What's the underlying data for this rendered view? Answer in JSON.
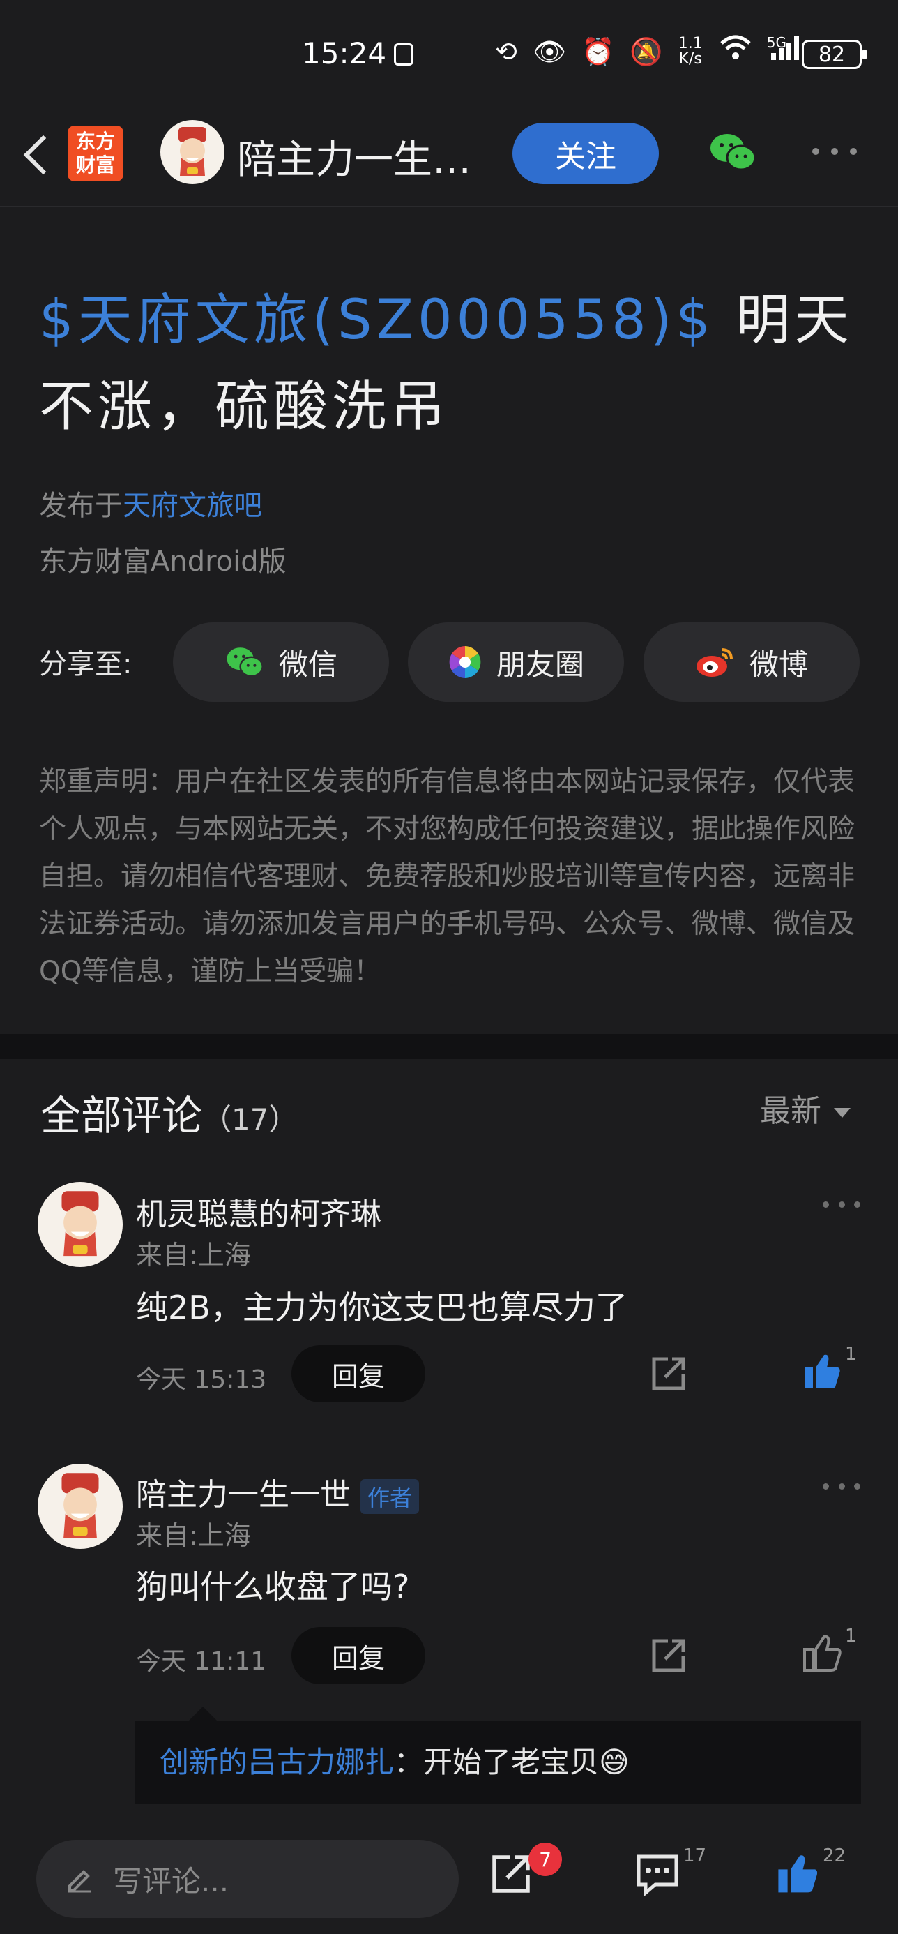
{
  "status_bar": {
    "time": "15:24",
    "speed_top": "1.1",
    "speed_bottom": "K/s",
    "network": "5G",
    "battery": "82"
  },
  "header": {
    "app_logo_line1": "东方",
    "app_logo_line2": "财富",
    "author_name": "陪主力一生…",
    "follow_label": "关注"
  },
  "post": {
    "title_stock": "$天府文旅(SZ000558)$",
    "title_text": " 明天不涨，硫酸洗吊",
    "published_prefix": "发布于",
    "board_name": "天府文旅吧",
    "client": "东方财富Android版",
    "share_label": "分享至:",
    "share_wechat": "微信",
    "share_moments": "朋友圈",
    "share_weibo": "微博",
    "disclaimer": "郑重声明：用户在社区发表的所有信息将由本网站记录保存，仅代表个人观点，与本网站无关，不对您构成任何投资建议，据此操作风险自担。请勿相信代客理财、免费荐股和炒股培训等宣传内容，远离非法证券活动。请勿添加发言用户的手机号码、公众号、微博、微信及QQ等信息，谨防上当受骗！"
  },
  "comments": {
    "title": "全部评论",
    "count": "（17）",
    "sort_label": "最新",
    "items": [
      {
        "user": "机灵聪慧的柯齐琳",
        "location": "来自:上海",
        "text": "纯2B，主力为你这支巴也算尽力了",
        "time": "今天  15:13",
        "reply_label": "回复",
        "likes": "1",
        "liked": true
      },
      {
        "user": "陪主力一生一世",
        "author_tag": "作者",
        "location": "来自:上海",
        "text": "狗叫什么收盘了吗?",
        "time": "今天  11:11",
        "reply_label": "回复",
        "likes": "1",
        "liked": false
      }
    ],
    "sub_reply": {
      "user": "创新的吕古力娜扎",
      "text": "：开始了老宝贝😅"
    }
  },
  "bottom_bar": {
    "input_placeholder": "写评论...",
    "share_badge": "7",
    "comment_count": "17",
    "like_count": "22"
  },
  "colors": {
    "background": "#1c1c1e",
    "accent_blue": "#3c80d8",
    "follow_button": "#2f6ecf",
    "brand_orange": "#f04e23",
    "badge_red": "#e8323c"
  }
}
